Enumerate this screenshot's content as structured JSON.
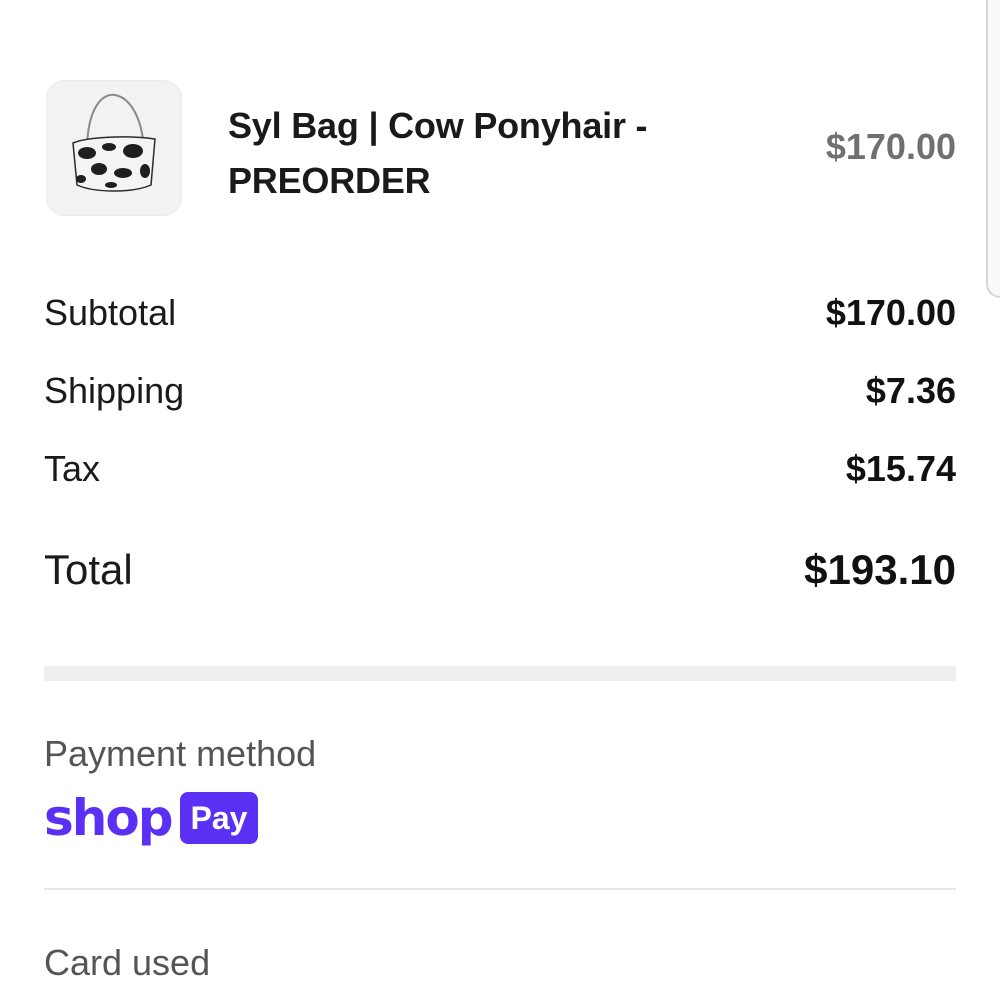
{
  "order_item": {
    "name": "Syl Bag | Cow Ponyhair - PREORDER",
    "price": "$170.00",
    "thumbnail_icon": "cow-print-bag-image"
  },
  "summary": {
    "subtotal_label": "Subtotal",
    "subtotal_value": "$170.00",
    "shipping_label": "Shipping",
    "shipping_value": "$7.36",
    "tax_label": "Tax",
    "tax_value": "$15.74",
    "total_label": "Total",
    "total_value": "$193.10"
  },
  "payment": {
    "heading": "Payment method",
    "logo_shop": "shop",
    "logo_pay": "Pay",
    "brand_color": "#5a31f4",
    "card_heading": "Card used"
  }
}
